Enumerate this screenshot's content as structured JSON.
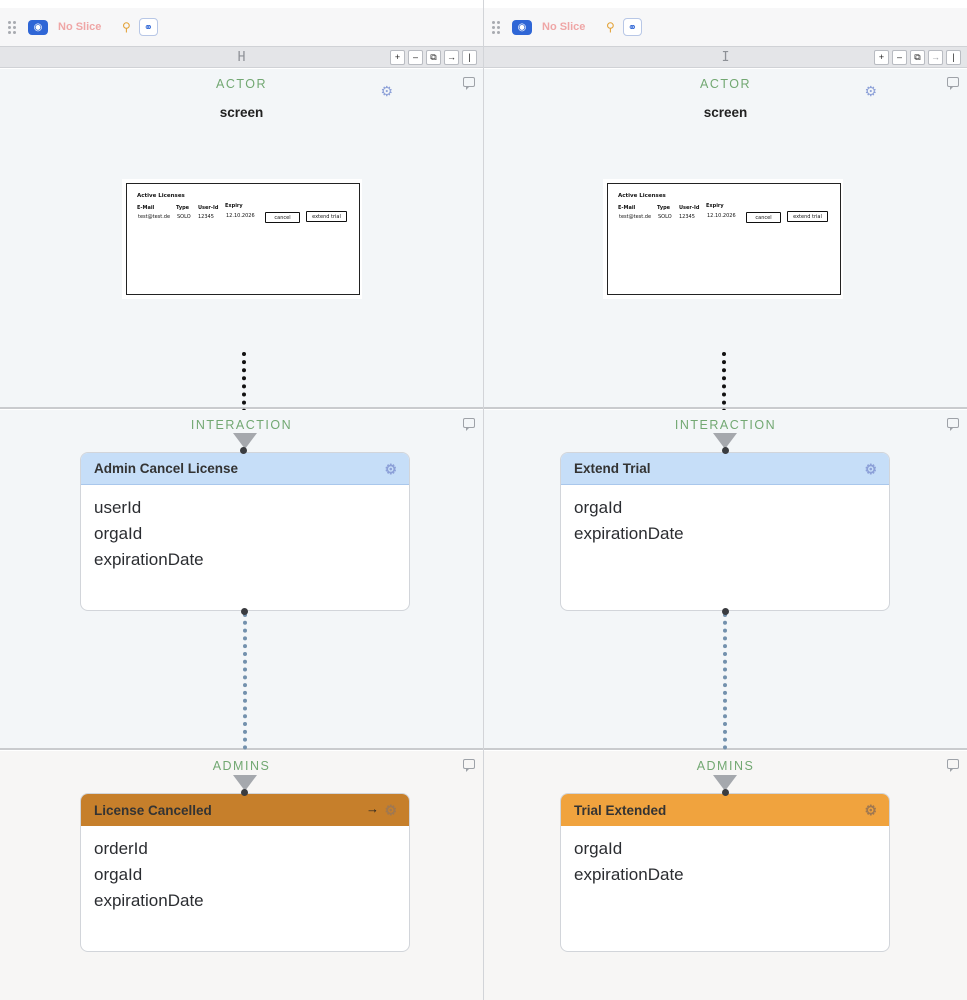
{
  "columns": [
    {
      "topbar": {
        "slice_label": "No Slice"
      },
      "letter": "H",
      "header_buttons": [
        "+",
        "–",
        "⧉",
        "→",
        "|"
      ],
      "lanes": {
        "actor": "ACTOR",
        "interaction": "INTERACTION",
        "admins": "ADMINS"
      },
      "screen": {
        "name": "screen",
        "mockup": {
          "title": "Active Licenses",
          "headers": [
            "E-Mail",
            "Type",
            "User-Id",
            "Expiry"
          ],
          "cells": [
            "test@test.de",
            "SOLO",
            "12345",
            "12.10.2026"
          ],
          "buttons": [
            "cancel",
            "extend trial"
          ]
        }
      },
      "command": {
        "title": "Admin Cancel License",
        "fields": [
          "userId",
          "orgaId",
          "expirationDate"
        ]
      },
      "event": {
        "title": "License Cancelled",
        "arrow": "→",
        "fields": [
          "orderId",
          "orgaId",
          "expirationDate"
        ],
        "color": "#c67f2b"
      }
    },
    {
      "topbar": {
        "slice_label": "No Slice"
      },
      "letter": "I",
      "header_buttons": [
        "+",
        "–",
        "⧉",
        "→",
        "|"
      ],
      "lanes": {
        "actor": "ACTOR",
        "interaction": "INTERACTION",
        "admins": "ADMINS"
      },
      "screen": {
        "name": "screen",
        "mockup": {
          "title": "Active Licenses",
          "headers": [
            "E-Mail",
            "Type",
            "User-Id",
            "Expiry"
          ],
          "cells": [
            "test@test.de",
            "SOLO",
            "12345",
            "12.10.2026"
          ],
          "buttons": [
            "cancel",
            "extend trial"
          ]
        }
      },
      "command": {
        "title": "Extend Trial",
        "fields": [
          "orgaId",
          "expirationDate"
        ]
      },
      "event": {
        "title": "Trial Extended",
        "fields": [
          "orgaId",
          "expirationDate"
        ],
        "color": "#f0a33e"
      }
    }
  ],
  "icons": {
    "grip": "drag-grip-icon",
    "eye": "eye-icon",
    "wand": "magic-wand-icon",
    "link": "link-icon",
    "gear": "gear-icon",
    "comment": "comment-icon"
  }
}
